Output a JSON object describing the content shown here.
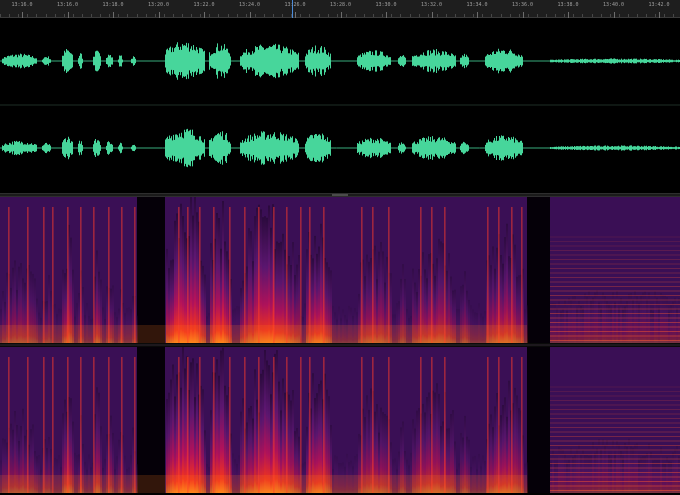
{
  "timeline": {
    "labels": [
      "13:16.0",
      "13:16.0",
      "13:18.0",
      "13:20.0",
      "13:22.0",
      "13:24.0",
      "13:26.0",
      "13:28.0",
      "13:30.0",
      "13:32.0",
      "13:34.0",
      "13:36.0",
      "13:38.0",
      "13:40.0",
      "13:42.0"
    ]
  },
  "colors": {
    "waveform": "#47d69b",
    "background": "#000000",
    "ruler": "#1e1e1e",
    "playhead": "#4a8ad8",
    "spectral_low": "#2a0a3c",
    "spectral_mid": "#b3125a",
    "spectral_high": "#ff7a1a"
  },
  "icons": [
    "divider-grip-icon"
  ]
}
